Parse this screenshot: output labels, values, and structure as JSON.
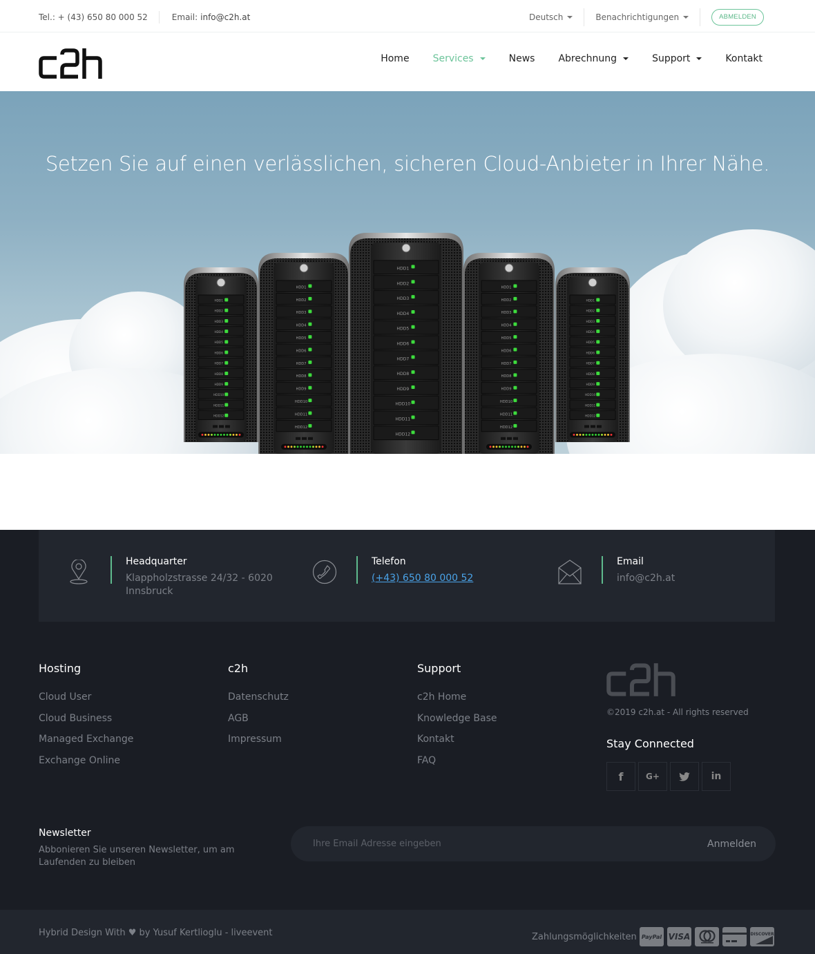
{
  "topbar": {
    "phone": "Tel.: + (43) 650 80 000 52",
    "email_label": "Email:",
    "email": "info@c2h.at",
    "language": "Deutsch",
    "notifications": "Benachrichtigungen",
    "logout": "ABMELDEN"
  },
  "brand": {
    "logo_text": "c2h",
    "accent": "#6cc49a"
  },
  "nav": {
    "items": [
      {
        "label": "Home",
        "dropdown": false,
        "active": false
      },
      {
        "label": "Services",
        "dropdown": true,
        "active": true
      },
      {
        "label": "News",
        "dropdown": false,
        "active": false
      },
      {
        "label": "Abrechnung",
        "dropdown": true,
        "active": false
      },
      {
        "label": "Support",
        "dropdown": true,
        "active": false
      },
      {
        "label": "Kontakt",
        "dropdown": false,
        "active": false
      }
    ]
  },
  "hero": {
    "headline": "Setzen Sie auf einen verlässlichen, sicheren Cloud-Anbieter in Ihrer Nähe.",
    "image_alt": "server-towers-in-clouds",
    "drive_labels": [
      "HDD1",
      "HDD2",
      "HDD3",
      "HDD4",
      "HDD5",
      "HDD6",
      "HDD7",
      "HDD8",
      "HDD9",
      "HDD10",
      "HDD11",
      "HDD12"
    ]
  },
  "contact": {
    "headquarter": {
      "title": "Headquarter",
      "line1": "Klappholzstrasse 24/32 - 6020",
      "line2": "Innsbruck",
      "icon": "map-pin-icon"
    },
    "phone": {
      "title": "Telefon",
      "value": "(+43) 650 80 000 52",
      "icon": "phone-icon"
    },
    "email": {
      "title": "Email",
      "value": "info@c2h.at",
      "icon": "envelope-icon"
    }
  },
  "footer": {
    "columns": [
      {
        "title": "Hosting",
        "links": [
          "Cloud User",
          "Cloud Business",
          "Managed Exchange",
          "Exchange Online"
        ]
      },
      {
        "title": "c2h",
        "links": [
          "Datenschutz",
          "AGB",
          "Impressum"
        ]
      },
      {
        "title": "Support",
        "links": [
          "c2h Home",
          "Knowledge Base",
          "Kontakt",
          "FAQ"
        ]
      }
    ],
    "logo_text": "c2h",
    "copyright": "©2019 c2h.at - All rights reserved",
    "stay_connected": "Stay Connected",
    "social": [
      {
        "name": "facebook",
        "glyph": "f"
      },
      {
        "name": "google-plus",
        "glyph": "G+"
      },
      {
        "name": "twitter",
        "glyph": "🐦"
      },
      {
        "name": "linkedin",
        "glyph": "in"
      }
    ]
  },
  "newsletter": {
    "title": "Newsletter",
    "description": "Abbonieren Sie unseren Newsletter, um am Laufenden zu bleiben",
    "placeholder": "Ihre Email Adresse eingeben",
    "value": "",
    "submit": "Anmelden"
  },
  "bottom": {
    "credit": "Hybrid Design With ♥ by Yusuf Kertlioglu - liveevent",
    "payment_label": "Zahlungsmöglichkeiten",
    "payment_methods": [
      "PayPal",
      "VISA",
      "mastercard",
      "card",
      "DISCOVER"
    ]
  }
}
